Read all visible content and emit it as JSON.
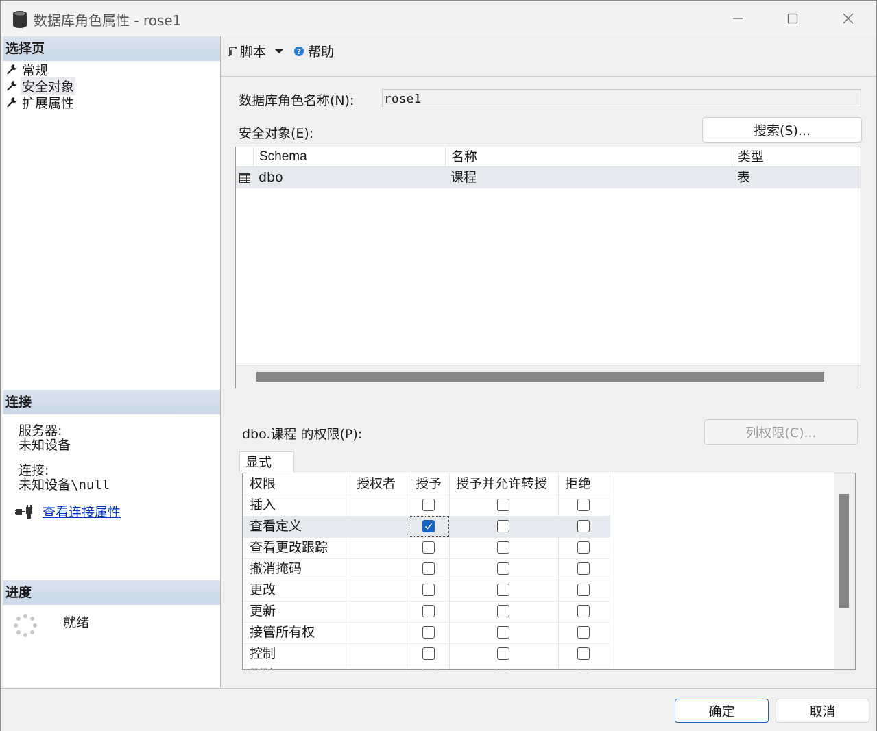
{
  "window": {
    "title": "数据库角色属性 - rose1",
    "icons": {
      "app": "database-icon",
      "minimize": "minimize-icon",
      "maximize": "maximize-icon",
      "close": "close-icon"
    }
  },
  "left": {
    "select_page": {
      "header": "选择页",
      "items": [
        {
          "label": "常规",
          "icon": "wrench-icon"
        },
        {
          "label": "安全对象",
          "icon": "wrench-icon",
          "selected": true
        },
        {
          "label": "扩展属性",
          "icon": "wrench-icon"
        }
      ]
    },
    "connection": {
      "header": "连接",
      "server_label": "服务器:",
      "server_value": "未知设备",
      "conn_label": "连接:",
      "conn_value": "未知设备\\null",
      "view_props_link": "查看连接属性"
    },
    "progress": {
      "header": "进度",
      "status": "就绪"
    }
  },
  "toolbar": {
    "script_label": "脚本",
    "help_label": "帮助"
  },
  "form": {
    "role_name_label": "数据库角色名称(N):",
    "role_name_value": "rose1",
    "securables_label": "安全对象(E):",
    "search_button": "搜索(S)...",
    "securables_grid": {
      "headers": [
        "Schema",
        "名称",
        "类型"
      ],
      "rows": [
        {
          "schema": "dbo",
          "name": "课程",
          "type": "表"
        }
      ]
    },
    "perm_label": "dbo.课程 的权限(P):",
    "column_perm_button": "列权限(C)...",
    "tab_label": "显式",
    "perm_grid": {
      "headers": [
        "权限",
        "授权者",
        "授予",
        "授予并允许转授",
        "拒绝"
      ],
      "rows": [
        {
          "perm": "插入",
          "grantor": "",
          "grant": false,
          "with_grant": false,
          "deny": false
        },
        {
          "perm": "查看定义",
          "grantor": "",
          "grant": true,
          "with_grant": false,
          "deny": false
        },
        {
          "perm": "查看更改跟踪",
          "grantor": "",
          "grant": false,
          "with_grant": false,
          "deny": false
        },
        {
          "perm": "撤消掩码",
          "grantor": "",
          "grant": false,
          "with_grant": false,
          "deny": false
        },
        {
          "perm": "更改",
          "grantor": "",
          "grant": false,
          "with_grant": false,
          "deny": false
        },
        {
          "perm": "更新",
          "grantor": "",
          "grant": false,
          "with_grant": false,
          "deny": false
        },
        {
          "perm": "接管所有权",
          "grantor": "",
          "grant": false,
          "with_grant": false,
          "deny": false
        },
        {
          "perm": "控制",
          "grantor": "",
          "grant": false,
          "with_grant": false,
          "deny": false
        },
        {
          "perm": "删除",
          "grantor": "",
          "grant": false,
          "with_grant": false,
          "deny": false
        }
      ]
    }
  },
  "footer": {
    "ok_button": "确定",
    "cancel_button": "取消"
  },
  "colors": {
    "accent": "#1464c8",
    "link": "#0033cc",
    "section_header": "#cbd8e6",
    "selected_row": "#e6e9ee"
  }
}
